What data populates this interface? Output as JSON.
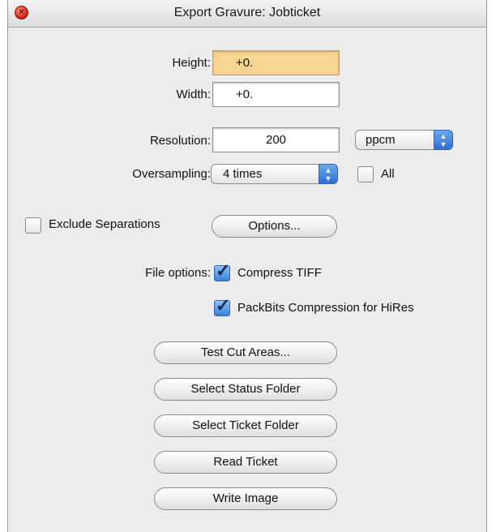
{
  "window": {
    "title": "Export Gravure: Jobticket"
  },
  "dimensions": {
    "height_label": "Height:",
    "height_value": "+0.",
    "width_label": "Width:",
    "width_value": "+0."
  },
  "resolution": {
    "label": "Resolution:",
    "value": "200",
    "unit": "ppcm"
  },
  "oversampling": {
    "label": "Oversampling:",
    "value": "4 times",
    "all_label": "All",
    "all_checked": false
  },
  "separations": {
    "exclude_label": "Exclude Separations",
    "exclude_checked": false,
    "options_label": "Options..."
  },
  "file_options": {
    "label": "File options:",
    "compress_tiff_label": "Compress TIFF",
    "compress_tiff_checked": true,
    "packbits_label": "PackBits Compression for HiRes",
    "packbits_checked": true
  },
  "actions": {
    "test_cut_areas": "Test Cut Areas...",
    "select_status_folder": "Select Status Folder",
    "select_ticket_folder": "Select Ticket Folder",
    "read_ticket": "Read Ticket",
    "write_image": "Write Image"
  },
  "icons": {
    "close": "close-icon",
    "popup_arrows": "updown-arrows-icon",
    "check": "checkmark-icon"
  },
  "colors": {
    "focus_field": "#f7d48f",
    "accent": "#3a80d8",
    "close": "#d8271a"
  }
}
